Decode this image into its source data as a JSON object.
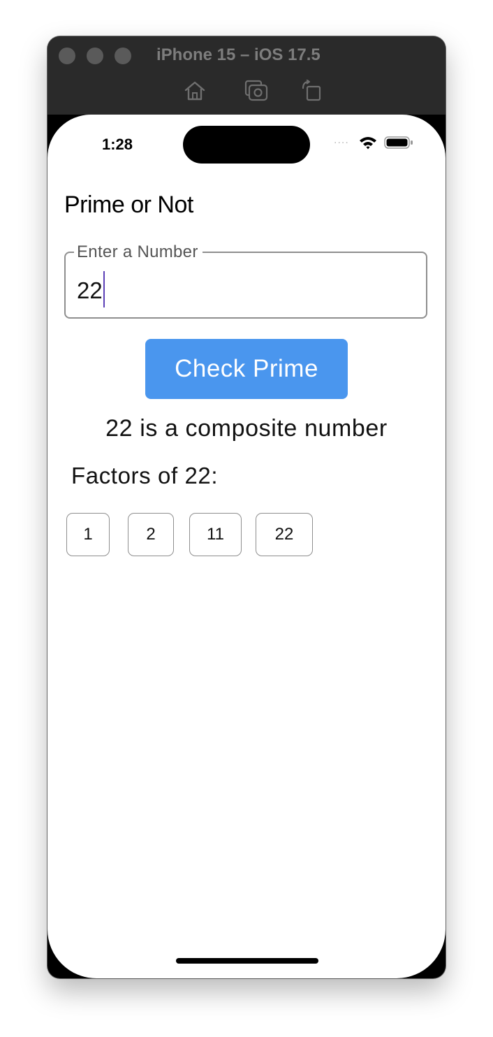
{
  "window": {
    "title": "iPhone 15 – iOS 17.5",
    "toolbar_icons": [
      "home-icon",
      "screenshot-icon",
      "rotate-icon"
    ]
  },
  "status_bar": {
    "time": "1:28",
    "signal": "....",
    "icons": [
      "wifi-icon",
      "battery-icon"
    ]
  },
  "app": {
    "title": "Prime or Not",
    "input": {
      "label": "Enter a Number",
      "value": "22"
    },
    "check_button_label": "Check Prime",
    "result": "22 is a composite number",
    "factors_heading": "Factors of 22:",
    "factors": [
      "1",
      "2",
      "11",
      "22"
    ]
  },
  "colors": {
    "button": "#4a96ee",
    "caret": "#5b3fb6",
    "titlebar": "#2a2a2a"
  }
}
